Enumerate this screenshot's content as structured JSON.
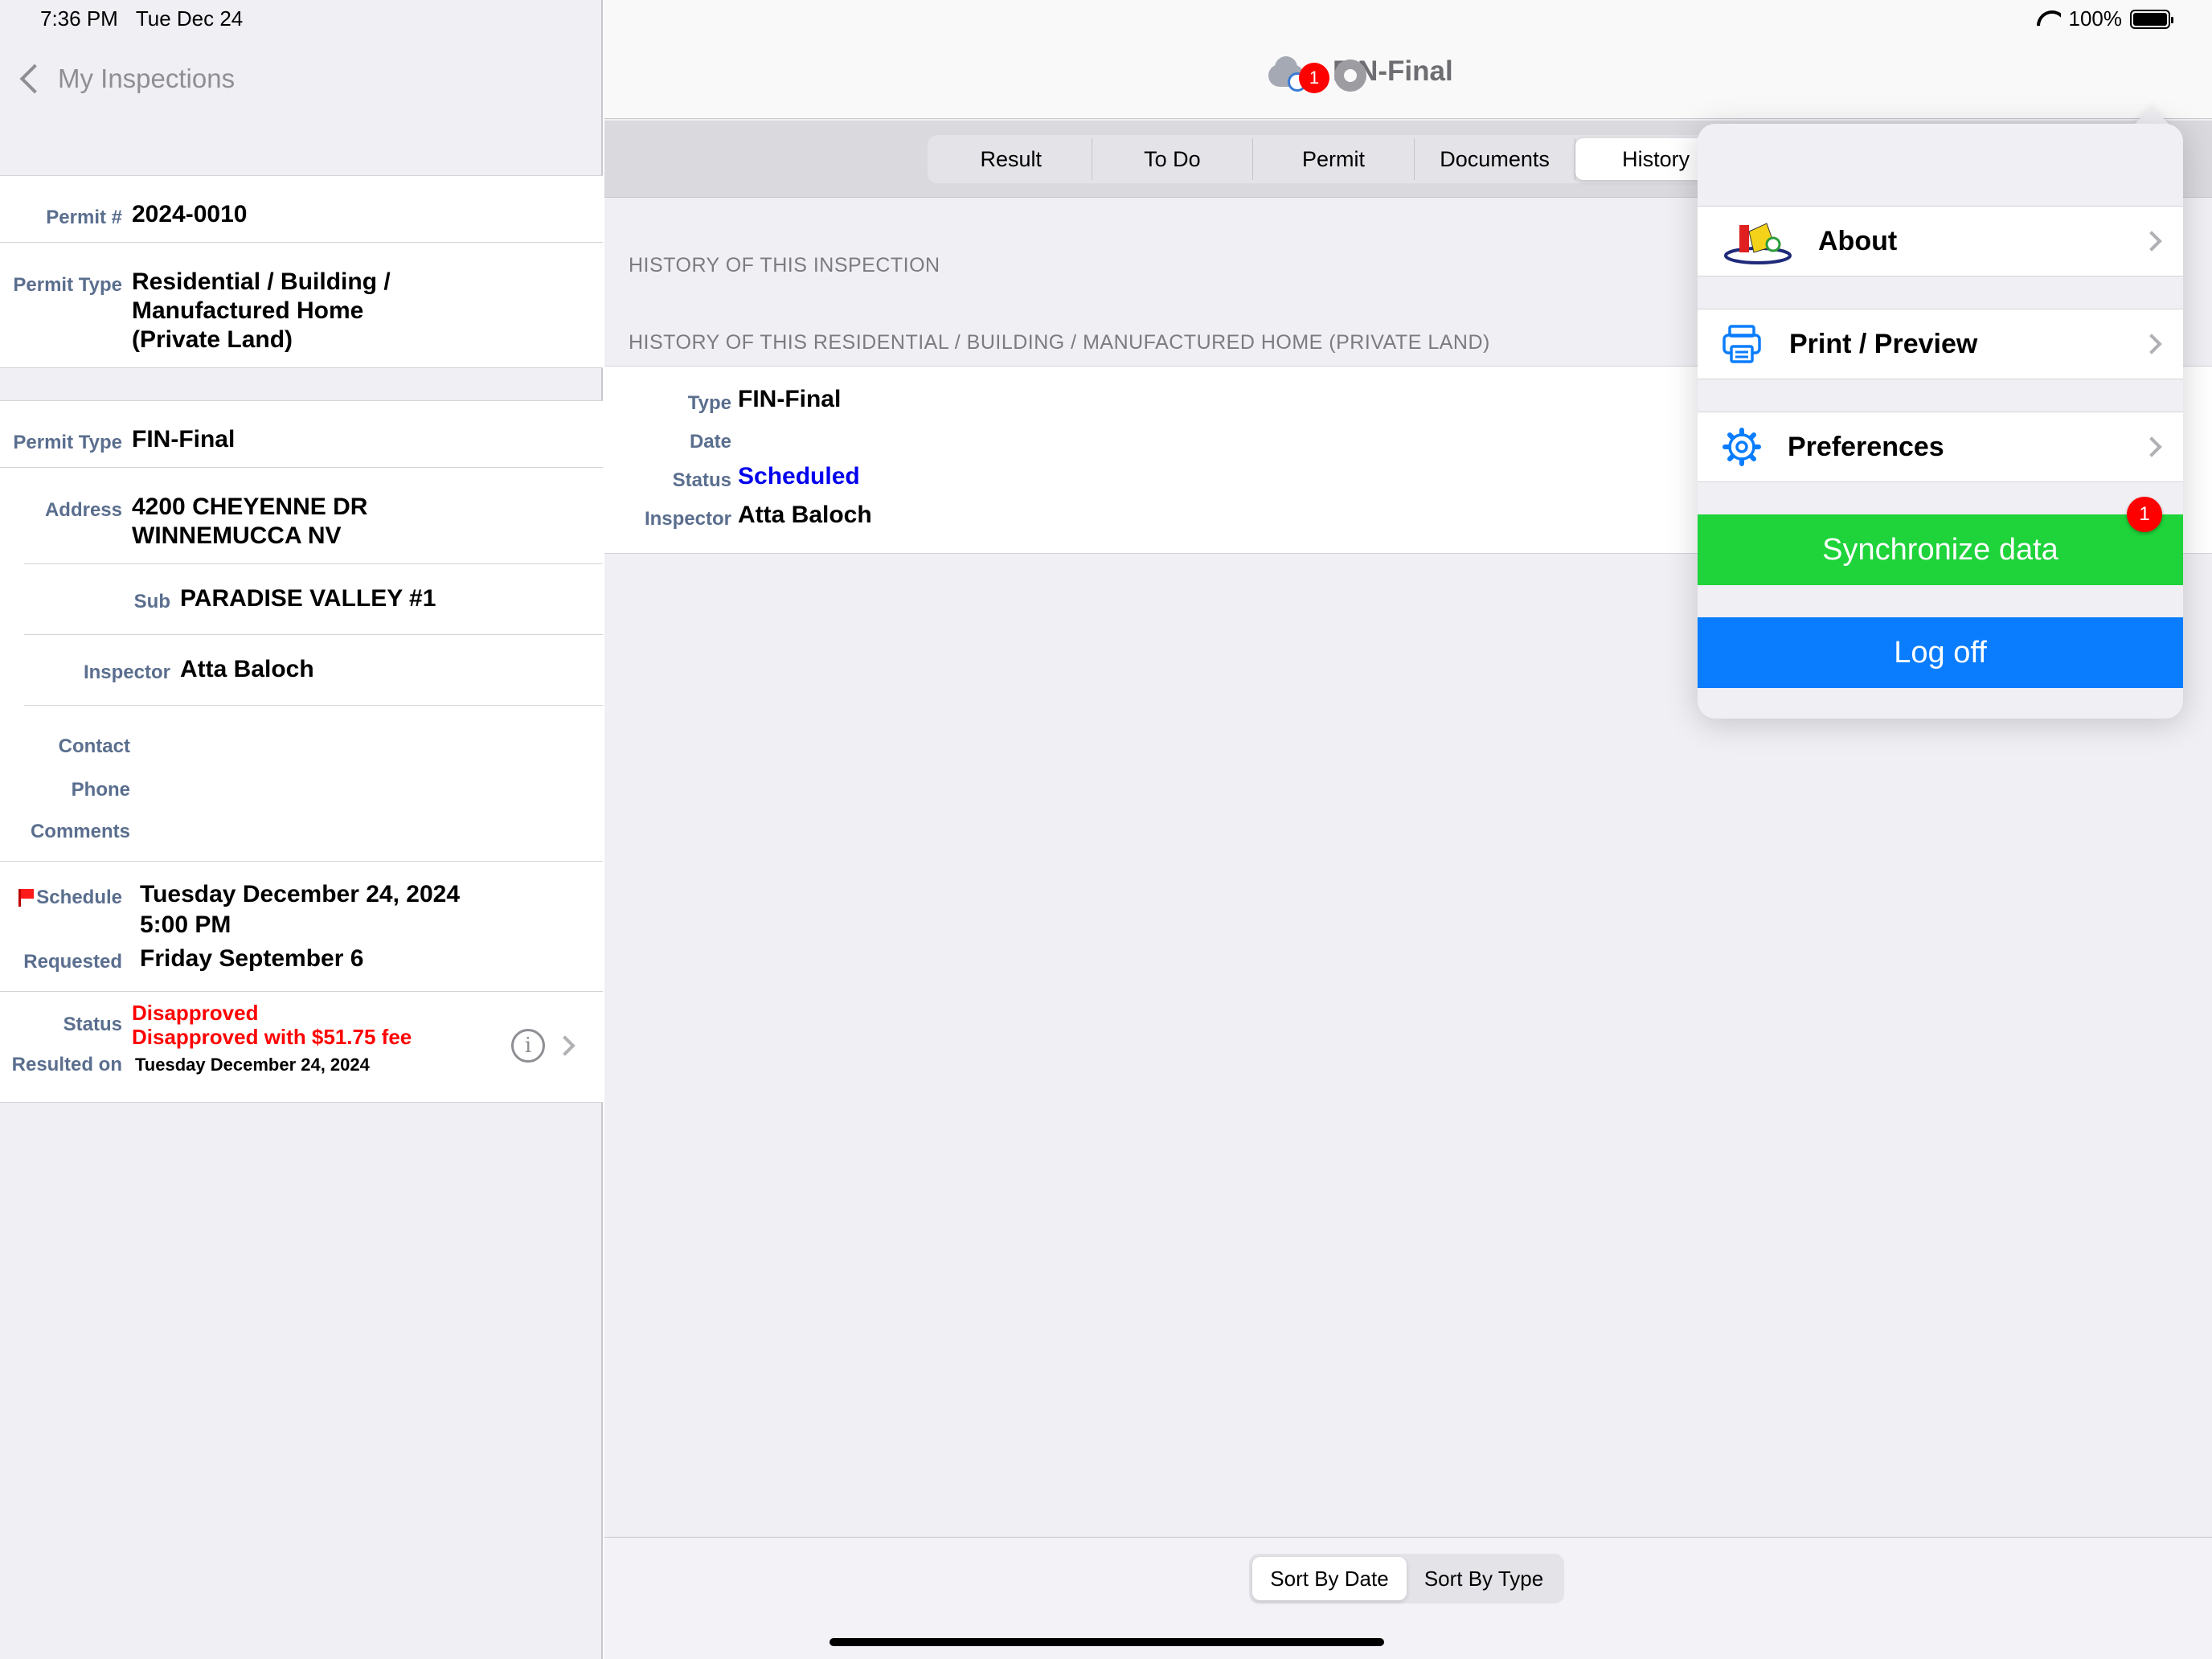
{
  "status_bar": {
    "time": "7:36 PM",
    "date": "Tue Dec 24",
    "battery": "100%"
  },
  "left": {
    "back_label": "My Inspections",
    "permit_number_label": "Permit #",
    "permit_number": "2024-0010",
    "permit_type_label": "Permit Type",
    "permit_type_line1": "Residential / Building /",
    "permit_type_line2": "Manufactured Home",
    "permit_type_line3": "(Private Land)",
    "inspection_type_label": "Permit Type",
    "inspection_type": "FIN-Final",
    "address_label": "Address",
    "address_line1": "4200 CHEYENNE DR",
    "address_line2": "WINNEMUCCA   NV",
    "sub_label": "Sub",
    "sub": "PARADISE VALLEY  #1",
    "inspector_label": "Inspector",
    "inspector": "Atta Baloch",
    "contact_label": "Contact",
    "phone_label": "Phone",
    "comments_label": "Comments",
    "schedule_label": "Schedule",
    "schedule_line1": "Tuesday December 24, 2024",
    "schedule_line2": "5:00 PM",
    "requested_label": "Requested",
    "requested": "Friday September 6",
    "status_label": "Status",
    "status_line1": "Disapproved",
    "status_line2": "Disapproved with $51.75 fee",
    "resulted_label": "Resulted on",
    "resulted": "Tuesday December 24, 2024"
  },
  "header": {
    "title": "FIN-Final",
    "badge_count": "1"
  },
  "tabs": [
    {
      "label": "Result"
    },
    {
      "label": "To Do"
    },
    {
      "label": "Permit"
    },
    {
      "label": "Documents"
    },
    {
      "label": "History"
    }
  ],
  "history": {
    "section1": "HISTORY OF THIS INSPECTION",
    "section2": "HISTORY OF THIS RESIDENTIAL / BUILDING / MANUFACTURED HOME (PRIVATE LAND)",
    "type_label": "Type",
    "type": "FIN-Final",
    "date_label": "Date",
    "status_label": "Status",
    "status": "Scheduled",
    "inspector_label": "Inspector",
    "inspector": "Atta Baloch"
  },
  "sort": {
    "by_date": "Sort By Date",
    "by_type": "Sort By Type"
  },
  "menu": {
    "about": "About",
    "print": "Print / Preview",
    "preferences": "Preferences",
    "sync": "Synchronize data",
    "sync_badge": "1",
    "logoff": "Log off"
  },
  "colors": {
    "sync": "#1fd33a",
    "logoff": "#0a7dff",
    "disapproved": "#ff0000",
    "scheduled": "#0000ee"
  }
}
